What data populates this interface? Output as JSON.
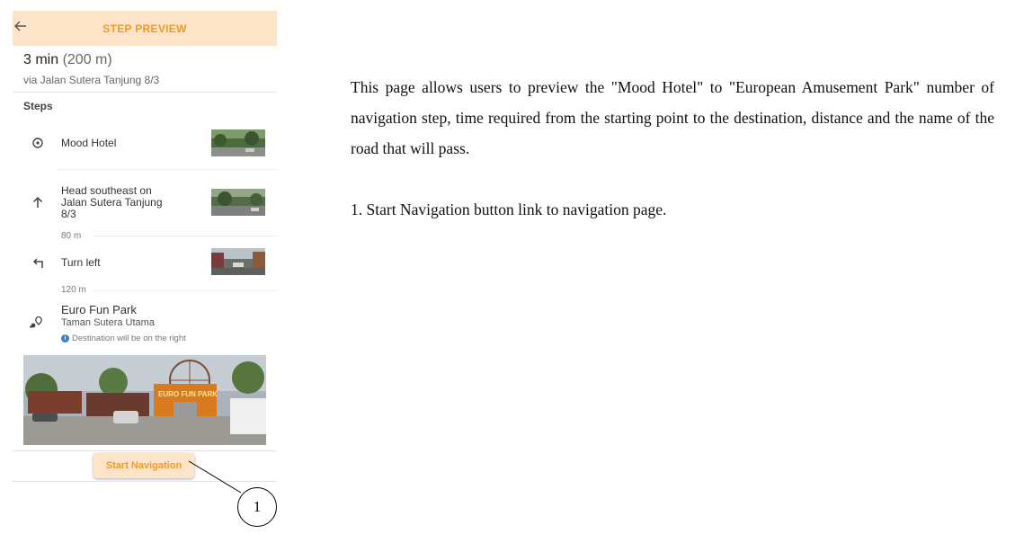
{
  "appbar": {
    "back_icon": "arrow-left-icon",
    "title": "STEP PREVIEW"
  },
  "summary": {
    "time": "3 min",
    "distance": "(200 m)",
    "via": "via Jalan Sutera Tanjung 8/3"
  },
  "steps_label": "Steps",
  "steps": [
    {
      "icon": "location-pin-icon",
      "text": "Mood Hotel"
    },
    {
      "icon": "arrow-up-icon",
      "text_lines": [
        "Head southeast on",
        "Jalan Sutera Tanjung",
        "8/3"
      ],
      "distance": "80 m"
    },
    {
      "icon": "turn-left-icon",
      "text": "Turn left",
      "distance": "120 m"
    },
    {
      "icon": "destination-icon",
      "text": "Euro Fun Park",
      "subtitle": "Taman Sutera Utama",
      "info": "Destination will be on the right"
    }
  ],
  "start_button": "Start Navigation",
  "callout_number": "1",
  "description": "This page allows users to preview the \"Mood Hotel\" to \"European Amusement Park\" number of navigation step, time required from the starting point to the destination, distance and the name of the road that will pass.",
  "note": "1. Start Navigation button link to navigation page.",
  "colors": {
    "accent": "#ee9a2b",
    "appbar_bg": "#fde3c7",
    "info": "#3b7bd4"
  }
}
